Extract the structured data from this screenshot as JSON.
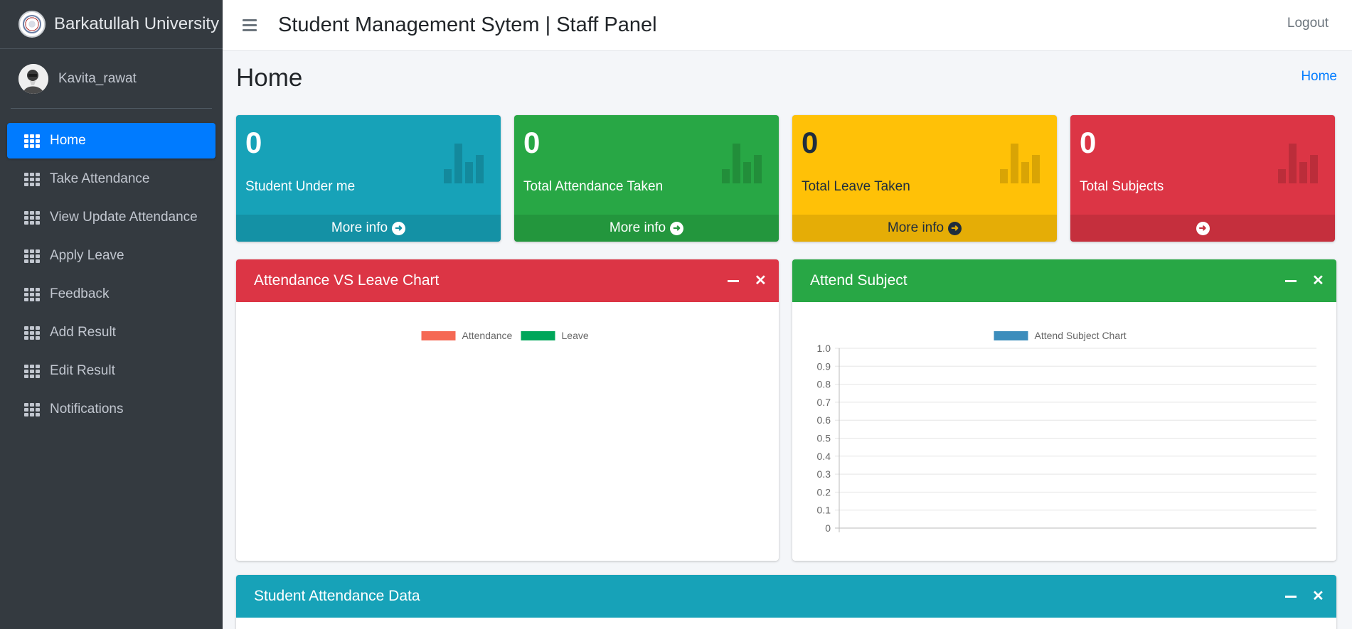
{
  "brand": {
    "name": "Barkatullah University"
  },
  "user": {
    "name": "Kavita_rawat"
  },
  "sidebar": {
    "items": [
      {
        "label": "Home",
        "active": true
      },
      {
        "label": "Take Attendance"
      },
      {
        "label": "View Update Attendance"
      },
      {
        "label": "Apply Leave"
      },
      {
        "label": "Feedback"
      },
      {
        "label": "Add Result"
      },
      {
        "label": "Edit Result"
      },
      {
        "label": "Notifications"
      }
    ]
  },
  "header": {
    "title": "Student Management Sytem | Staff Panel",
    "logout": "Logout"
  },
  "page": {
    "title": "Home",
    "breadcrumb": "Home"
  },
  "stats": [
    {
      "value": "0",
      "label": "Student Under me",
      "footer": "More info",
      "color": "#17a2b8"
    },
    {
      "value": "0",
      "label": "Total Attendance Taken",
      "footer": "More info",
      "color": "#28a745"
    },
    {
      "value": "0",
      "label": "Total Leave Taken",
      "footer": "More info",
      "color": "#ffc107"
    },
    {
      "value": "0",
      "label": "Total Subjects",
      "footer": "",
      "color": "#dc3545"
    }
  ],
  "cards": {
    "attendance_leave": {
      "title": "Attendance VS Leave Chart"
    },
    "attend_subject": {
      "title": "Attend Subject"
    },
    "student_attendance": {
      "title": "Student Attendance Data"
    }
  },
  "chart_data": [
    {
      "type": "pie",
      "legend": [
        "Attendance",
        "Leave"
      ],
      "colors": [
        "#f56954",
        "#00a65a"
      ],
      "values": [
        0,
        0
      ],
      "legend_position": "top"
    },
    {
      "type": "bar",
      "series": [
        {
          "name": "Attend Subject Chart",
          "values": [],
          "color": "#3c8dbc"
        }
      ],
      "categories": [],
      "ylim": [
        0,
        1.0
      ],
      "yticks": [
        "1.0",
        "0.9",
        "0.8",
        "0.7",
        "0.6",
        "0.5",
        "0.4",
        "0.3",
        "0.2",
        "0.1",
        "0"
      ],
      "grid": true,
      "legend_position": "top"
    }
  ]
}
